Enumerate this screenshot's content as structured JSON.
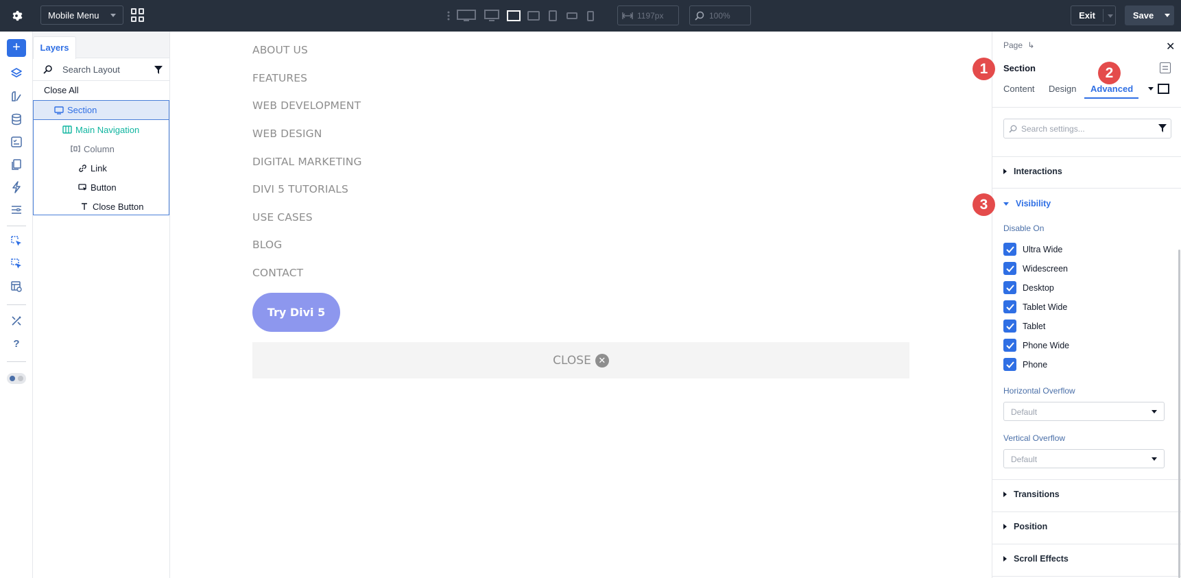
{
  "topbar": {
    "layout_name": "Mobile Menu",
    "width_value": "1197px",
    "zoom_value": "100%",
    "exit_label": "Exit",
    "save_label": "Save"
  },
  "layers": {
    "tab_label": "Layers",
    "search_placeholder": "Search Layout",
    "close_all": "Close All",
    "tree": [
      {
        "label": "Section"
      },
      {
        "label": "Main Navigation"
      },
      {
        "label": "Column"
      },
      {
        "label": "Link"
      },
      {
        "label": "Button"
      },
      {
        "label": "Close Button"
      }
    ]
  },
  "canvas": {
    "menu_links": [
      "ABOUT US",
      "FEATURES",
      "WEB DEVELOPMENT",
      "WEB DESIGN",
      "DIGITAL MARKETING",
      "DIVI 5 TUTORIALS",
      "USE CASES",
      "BLOG",
      "CONTACT"
    ],
    "button_label": "Try Divi 5",
    "close_label": "CLOSE"
  },
  "panel": {
    "breadcrumb": "Page",
    "title": "Section",
    "tabs": [
      "Content",
      "Design",
      "Advanced"
    ],
    "search_placeholder": "Search settings...",
    "sections": {
      "interactions": "Interactions",
      "visibility": "Visibility",
      "transitions": "Transitions",
      "position": "Position",
      "scroll_effects": "Scroll Effects"
    },
    "disable_on_label": "Disable On",
    "disable_on": [
      "Ultra Wide",
      "Widescreen",
      "Desktop",
      "Tablet Wide",
      "Tablet",
      "Phone Wide",
      "Phone"
    ],
    "horizontal_overflow_label": "Horizontal Overflow",
    "horizontal_overflow_value": "Default",
    "vertical_overflow_label": "Vertical Overflow",
    "vertical_overflow_value": "Default"
  },
  "annotations": [
    "1",
    "2",
    "3"
  ]
}
